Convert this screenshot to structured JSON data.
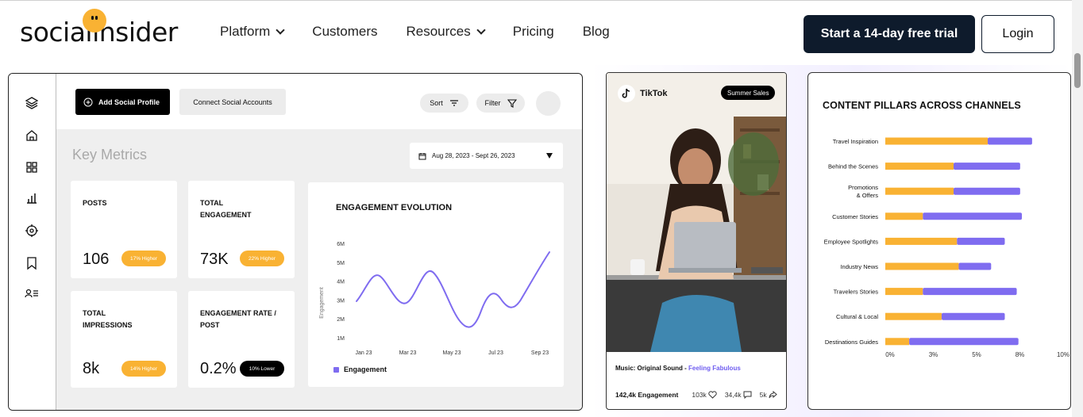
{
  "header": {
    "logo_text": "socialinsider",
    "nav": [
      {
        "label": "Platform",
        "dropdown": true
      },
      {
        "label": "Customers",
        "dropdown": false
      },
      {
        "label": "Resources",
        "dropdown": true
      },
      {
        "label": "Pricing",
        "dropdown": false
      },
      {
        "label": "Blog",
        "dropdown": false
      }
    ],
    "cta_trial": "Start a 14-day free trial",
    "cta_login": "Login"
  },
  "dashboard": {
    "sidebar_icons": [
      "layers-icon",
      "home-icon",
      "grid-icon",
      "bar-chart-icon",
      "target-icon",
      "bookmark-icon",
      "users-list-icon"
    ],
    "add_profile": "Add Social Profile",
    "connect_accounts": "Connect  Social Accounts",
    "sort": "Sort",
    "filter": "Filter",
    "key_metrics_title": "Key Metrics",
    "date_range": "Aug 28, 2023 - Sept 26, 2023",
    "metrics": [
      {
        "label": "POSTS",
        "value": "106",
        "badge": "17% Higher"
      },
      {
        "label": "TOTAL ENGAGEMENT",
        "value": "73K",
        "badge": "22% Higher"
      },
      {
        "label": "TOTAL IMPRESSIONS",
        "value": "8k",
        "badge": "14% Higher"
      },
      {
        "label": "ENGAGEMENT RATE / POST",
        "value": "0.2%",
        "badge": "10% Lower"
      }
    ],
    "engagement_chart": {
      "title": "ENGAGEMENT EVOLUTION",
      "ylabel": "Engagement",
      "y_ticks": [
        "6M",
        "5M",
        "4M",
        "3M",
        "2M",
        "1M"
      ],
      "x_ticks": [
        "Jan 23",
        "Mar 23",
        "May 23",
        "Jul 23",
        "Sep 23"
      ],
      "legend": "Engagement",
      "color": "#7f6cf0"
    }
  },
  "tiktok": {
    "platform": "TikTok",
    "tag": "Summer Sales",
    "music_prefix": "Music: Original Sound - ",
    "music_title": "Feeling Fabulous",
    "engagement": "142,4k Engagement",
    "likes": "103k",
    "comments": "34,4k",
    "shares": "5k"
  },
  "chart_data": {
    "type": "bar",
    "title": "CONTENT PILLARS ACROSS CHANNELS",
    "stacked": true,
    "orientation": "horizontal",
    "categories": [
      "Travel Inspiration",
      "Behind the Scenes",
      "Promotions\n& Offers",
      "Customer Stories",
      "Employee Spotlights",
      "Industry News",
      "Travelers Stories",
      "Cultural & Local",
      "Destinations Guides"
    ],
    "series": [
      {
        "values": [
          6.0,
          4.0,
          4.0,
          2.2,
          4.2,
          4.3,
          2.2,
          3.3,
          1.4
        ],
        "color": "#f9b233"
      },
      {
        "values": [
          2.6,
          3.9,
          3.9,
          5.8,
          2.8,
          1.9,
          5.5,
          3.7,
          6.4
        ],
        "color": "#7f6cf0"
      }
    ],
    "x_ticks": [
      "0%",
      "3%",
      "5%",
      "8%",
      "10%"
    ],
    "xlim": [
      0,
      10
    ]
  }
}
